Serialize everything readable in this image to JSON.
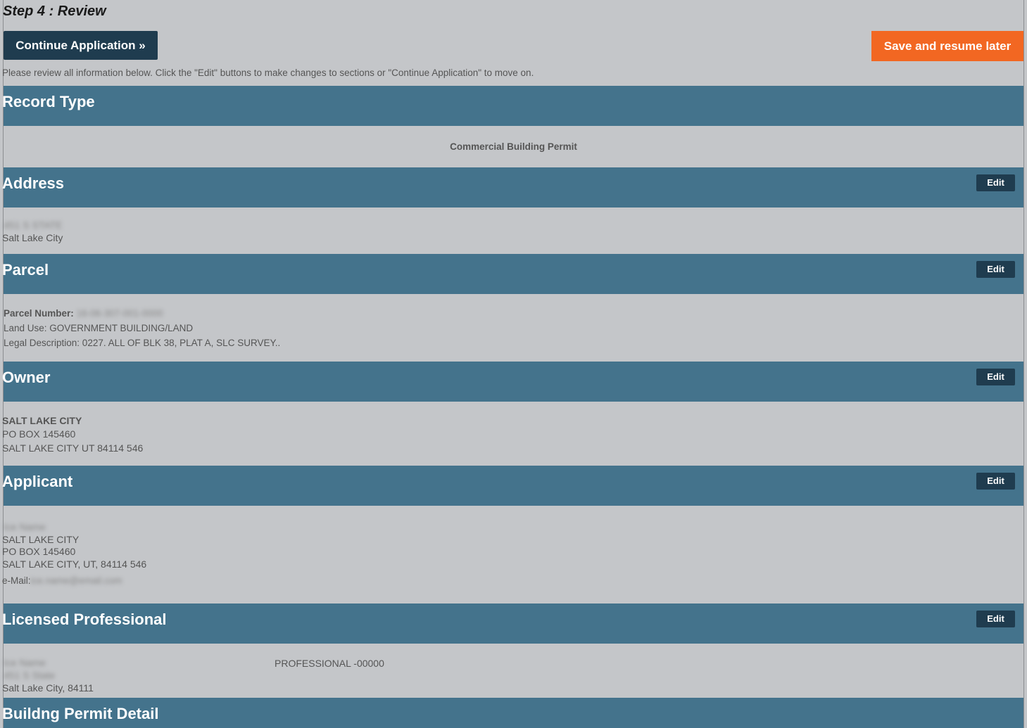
{
  "step_title": "Step 4 : Review",
  "buttons": {
    "continue": "Continue Application »",
    "save_resume": "Save and resume later",
    "edit": "Edit"
  },
  "instructions": "Please review all information below. Click the \"Edit\" buttons to make changes to sections or \"Continue Application\" to move on.",
  "sections": {
    "record_type": {
      "title": "Record Type",
      "value": "Commercial Building Permit"
    },
    "address": {
      "title": "Address",
      "line1_blurred": "451 S STATE",
      "city": "Salt Lake City"
    },
    "parcel": {
      "title": "Parcel",
      "number_label": "Parcel Number:",
      "number_blurred": "16-06-307-001-0000",
      "land_use": "Land Use: GOVERNMENT BUILDING/LAND",
      "legal_description": "Legal Description: 0227. ALL OF BLK 38, PLAT A, SLC SURVEY.."
    },
    "owner": {
      "title": "Owner",
      "name": "SALT LAKE CITY",
      "address1": "PO BOX 145460",
      "address2": "SALT LAKE CITY UT 84114 546"
    },
    "applicant": {
      "title": "Applicant",
      "name_blurred": "Ice Name",
      "org": "SALT LAKE CITY",
      "address1": "PO BOX 145460",
      "address2": "SALT LAKE CITY, UT, 84114 546",
      "email_label": "e-Mail:",
      "email_blurred": "ice.name@email.com"
    },
    "licensed_professional": {
      "title": "Licensed Professional",
      "name_blurred": "Ice Name",
      "street_blurred": "451 S State",
      "city": "Salt Lake City, 84111",
      "license": "PROFESSIONAL -00000"
    },
    "permit_detail": {
      "title": "Buildng Permit Detail"
    }
  }
}
